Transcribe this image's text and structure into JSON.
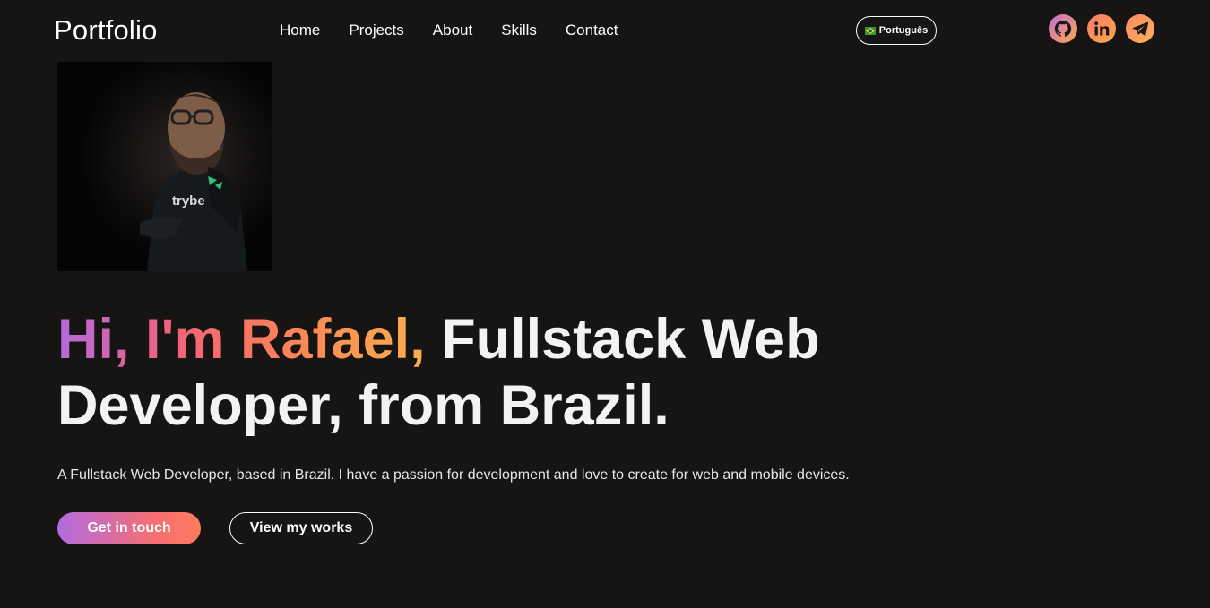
{
  "brand": "Portfolio",
  "nav": {
    "items": [
      {
        "label": "Home"
      },
      {
        "label": "Projects"
      },
      {
        "label": "About"
      },
      {
        "label": "Skills"
      },
      {
        "label": "Contact"
      }
    ]
  },
  "language_button": {
    "label": "Português",
    "flag_icon": "brazil-flag-icon"
  },
  "social": [
    {
      "icon": "github-icon"
    },
    {
      "icon": "linkedin-icon"
    },
    {
      "icon": "telegram-icon"
    }
  ],
  "profile_photo": {
    "shirt_text": "trybe"
  },
  "hero": {
    "greeting": "Hi, I'm Rafael,",
    "headline_rest": " Fullstack Web Developer, from Brazil.",
    "description": "A Fullstack Web Developer, based in Brazil. I have a passion for development and love to create for web and mobile devices.",
    "primary_button": "Get in touch",
    "secondary_button": "View my works"
  },
  "colors": {
    "background": "#161514",
    "gradient_start": "#b36be0",
    "gradient_mid": "#f1607b",
    "gradient_end": "#fbb04c",
    "text": "#f2f2f2"
  }
}
